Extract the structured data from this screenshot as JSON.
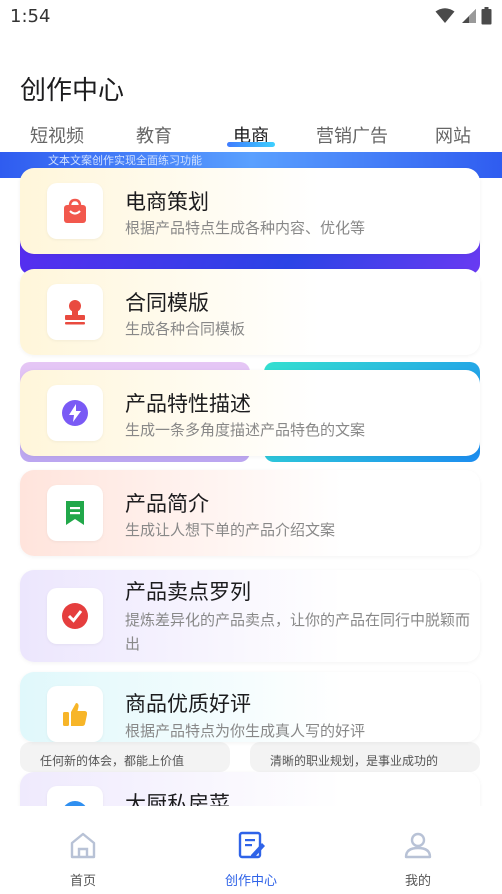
{
  "status_bar": {
    "time": "1:54",
    "icons": [
      "wifi-icon",
      "signal-icon",
      "battery-icon"
    ]
  },
  "page_title": "创作中心",
  "tabs": [
    {
      "label": "短视频",
      "active": false
    },
    {
      "label": "教育",
      "active": false
    },
    {
      "label": "电商",
      "active": true
    },
    {
      "label": "营销广告",
      "active": false
    },
    {
      "label": "网站",
      "active": false
    }
  ],
  "background": {
    "caption_top": "文本文案创作实现全面练习功能",
    "caption_left": "任何新的体会，都能上价值",
    "caption_right": "清晰的职业规划，是事业成功的"
  },
  "cards": [
    {
      "title": "电商策划",
      "desc": "根据产品特点生成各种内容、优化等",
      "icon": "shopping-bag-icon",
      "icon_color": "#f2584d"
    },
    {
      "title": "合同模版",
      "desc": "生成各种合同模板",
      "icon": "stamp-icon",
      "icon_color": "#e94a3f"
    },
    {
      "title": "产品特性描述",
      "desc": "生成一条多角度描述产品特色的文案",
      "icon": "lightning-icon",
      "icon_color": "#7a5af5"
    },
    {
      "title": "产品简介",
      "desc": "生成让人想下单的产品介绍文案",
      "icon": "bookmark-icon",
      "icon_color": "#21a84a"
    },
    {
      "title": "产品卖点罗列",
      "desc": "提炼差异化的产品卖点，让你的产品在同行中脱颖而出",
      "icon": "check-badge-icon",
      "icon_color": "#e53e3e"
    },
    {
      "title": "商品优质好评",
      "desc": "根据产品特点为你生成真人写的好评",
      "icon": "thumbs-up-icon",
      "icon_color": "#f7b528"
    },
    {
      "title": "大厨私房菜",
      "desc": "",
      "icon": "chef-icon",
      "icon_color": "#2f8ff0"
    }
  ],
  "bottom_nav": [
    {
      "label": "首页",
      "icon": "home-icon",
      "active": false
    },
    {
      "label": "创作中心",
      "icon": "edit-document-icon",
      "active": true
    },
    {
      "label": "我的",
      "icon": "profile-icon",
      "active": false
    }
  ],
  "colors": {
    "accent": "#2f63e8",
    "tab_underline": "#3f7cff"
  }
}
